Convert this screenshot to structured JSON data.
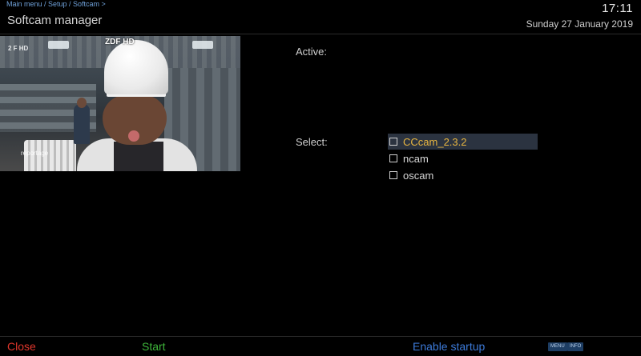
{
  "header": {
    "breadcrumb": "Main menu / Setup / Softcam >",
    "title": "Softcam manager",
    "time": "17:11",
    "date": "Sunday 27 January 2019"
  },
  "preview": {
    "station_logo": "2 F HD",
    "channel_name": "ZDF HD",
    "program_logo": "reportage"
  },
  "main": {
    "active_label": "Active:",
    "select_label": "Select:",
    "options": [
      {
        "label": "CCcam_2.3.2",
        "checked": false,
        "selected": true
      },
      {
        "label": "ncam",
        "checked": false,
        "selected": false
      },
      {
        "label": "oscam",
        "checked": false,
        "selected": false
      }
    ]
  },
  "footer": {
    "red_label": "Close",
    "green_label": "Start",
    "blue_label": "Enable startup",
    "menu_badge": "MENU",
    "info_badge": "INFO"
  },
  "colors": {
    "selected_text": "#e8b640",
    "red_key": "#e0362c",
    "green_key": "#3eb53a",
    "blue_key": "#3c7ad8"
  }
}
